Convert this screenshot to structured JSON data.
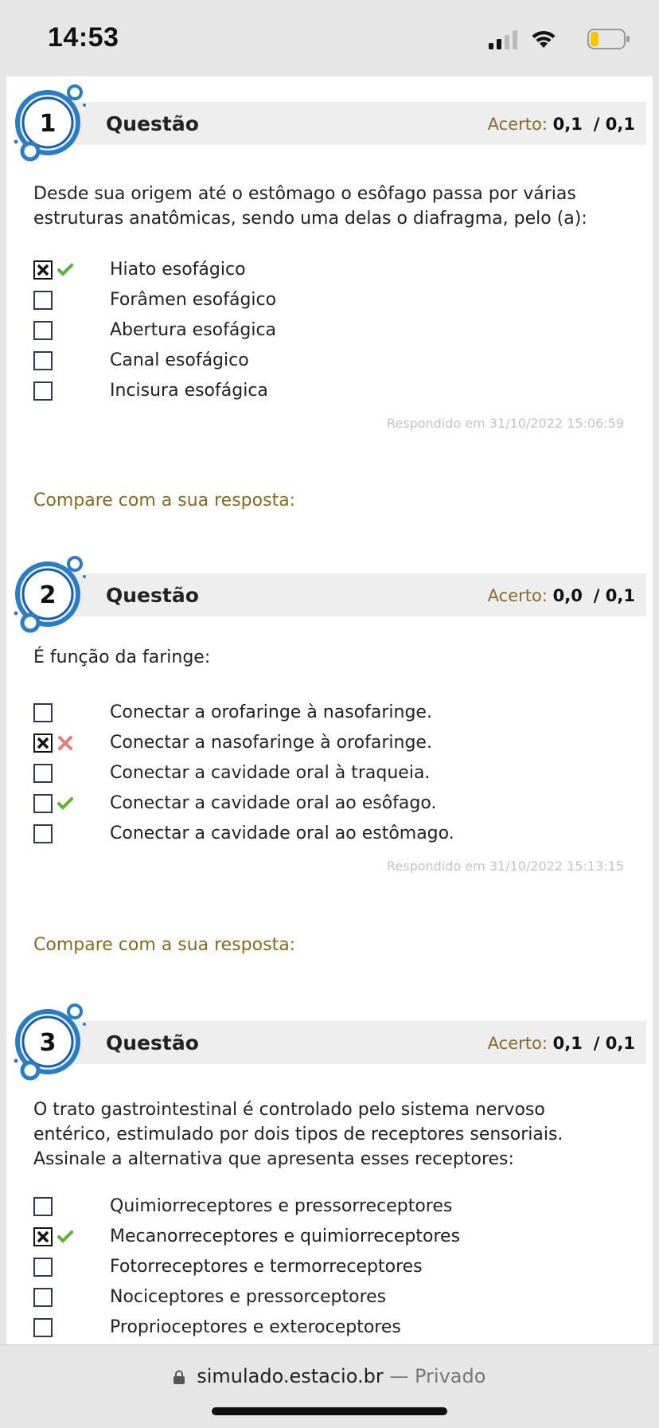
{
  "status_bar": {
    "time": "14:53"
  },
  "questions": [
    {
      "number": "1",
      "title": "Questão",
      "score_label": "Acerto:",
      "score": "0,1",
      "max": "0,1",
      "text": "Desde sua origem até o estômago o esôfago passa por várias estruturas anatômicas, sendo uma delas o diafragma, pelo (a):",
      "options": [
        {
          "label": "Hiato esofágico",
          "checked": true,
          "mark": "correct"
        },
        {
          "label": "Forâmen esofágico",
          "checked": false,
          "mark": ""
        },
        {
          "label": "Abertura esofágica",
          "checked": false,
          "mark": ""
        },
        {
          "label": "Canal esofágico",
          "checked": false,
          "mark": ""
        },
        {
          "label": "Incisura esofágica",
          "checked": false,
          "mark": ""
        }
      ],
      "answered": "Respondido em 31/10/2022 15:06:59",
      "compare": "Compare com a sua resposta:"
    },
    {
      "number": "2",
      "title": "Questão",
      "score_label": "Acerto:",
      "score": "0,0",
      "max": "0,1",
      "text": "É função da faringe:",
      "options": [
        {
          "label": "Conectar a orofaringe à nasofaringe.",
          "checked": false,
          "mark": ""
        },
        {
          "label": "Conectar a nasofaringe à orofaringe.",
          "checked": true,
          "mark": "wrong"
        },
        {
          "label": "Conectar a cavidade oral à traqueia.",
          "checked": false,
          "mark": ""
        },
        {
          "label": "Conectar a cavidade oral ao esôfago.",
          "checked": false,
          "mark": "correct"
        },
        {
          "label": "Conectar a cavidade oral ao estômago.",
          "checked": false,
          "mark": ""
        }
      ],
      "answered": "Respondido em 31/10/2022 15:13:15",
      "compare": "Compare com a sua resposta:"
    },
    {
      "number": "3",
      "title": "Questão",
      "score_label": "Acerto:",
      "score": "0,1",
      "max": "0,1",
      "text_lines": [
        "O trato gastrointestinal é controlado pelo sistema nervoso",
        "entérico, estimulado por dois tipos de receptores sensoriais.",
        "Assinale a alternativa que apresenta esses receptores:"
      ],
      "options": [
        {
          "label": "Quimiorreceptores e pressorreceptores",
          "checked": false,
          "mark": ""
        },
        {
          "label": "Mecanorreceptores e quimiorreceptores",
          "checked": true,
          "mark": "correct"
        },
        {
          "label": "Fotorreceptores e termorreceptores",
          "checked": false,
          "mark": ""
        },
        {
          "label": "Nociceptores e pressorceptores",
          "checked": false,
          "mark": ""
        },
        {
          "label": "Proprioceptores e exteroceptores",
          "checked": false,
          "mark": ""
        }
      ]
    }
  ],
  "address_bar": {
    "domain": "simulado.estacio.br",
    "separator": "—",
    "mode": "Privado"
  },
  "colors": {
    "accent_gold": "#8a6a1a",
    "header_bg": "#eeeeee",
    "badge_blue": "#2a7cc7",
    "correct_green": "#5cb531",
    "wrong_red": "#d9534f"
  }
}
